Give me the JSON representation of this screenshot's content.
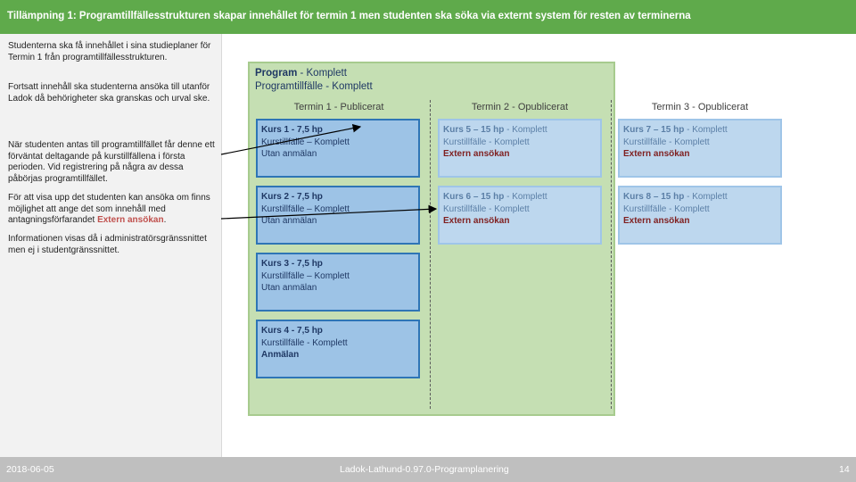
{
  "header": {
    "title": "Tillämpning 1: Programtillfällesstrukturen skapar innehållet för termin 1 men studenten ska söka via externt system för resten av terminerna"
  },
  "sidebar": {
    "p1": "Studenterna ska få innehållet i sina studieplaner för Termin 1 från programtillfällesstrukturen.",
    "p2": "Fortsatt innehåll ska studenterna ansöka till utanför Ladok då behörigheter ska granskas och urval ske.",
    "p3": "När studenten antas till programtillfället får denne ett förväntat deltagande på kurstillfällena i första perioden. Vid registrering på några av dessa påbörjas programtillfället.",
    "p4_a": "För att visa upp det studenten kan ansöka om finns möjlighet att ange det som innehåll med antagningsförfarandet ",
    "p4_ext": "Extern ansökan",
    "p4_b": ".",
    "p5": "Informationen visas då i administratörsgränssnittet men ej i studentgränssnittet."
  },
  "program": {
    "label": "Program",
    "label_rest": " - Komplett",
    "tillfalle": "Programtillfälle - Komplett"
  },
  "terms": [
    {
      "label": "Termin 1 - Publicerat"
    },
    {
      "label": "Termin 2 - Opublicerat"
    },
    {
      "label": "Termin 3 - Opublicerat"
    }
  ],
  "courses": [
    {
      "title": "Kurs 1 - 7,5 hp",
      "title_rest": "",
      "status": "Kurstillfälle – Komplett",
      "mode": "Utan anmälan"
    },
    {
      "title": "Kurs 2 - 7,5 hp",
      "title_rest": "",
      "status": "Kurstillfälle – Komplett",
      "mode": "Utan anmälan"
    },
    {
      "title": "Kurs 3 - 7,5 hp",
      "title_rest": "",
      "status": "Kurstillfälle – Komplett",
      "mode": "Utan anmälan"
    },
    {
      "title": "Kurs 4 - 7,5 hp",
      "title_rest": "",
      "status": "Kurstillfälle - Komplett",
      "mode": "Anmälan"
    },
    {
      "title": "Kurs 5 – 15 hp",
      "title_rest": " - Komplett",
      "status": "Kurstillfälle - Komplett",
      "mode": "Extern ansökan"
    },
    {
      "title": "Kurs 6 – 15 hp",
      "title_rest": " - Komplett",
      "status": "Kurstillfälle - Komplett",
      "mode": "Extern ansökan"
    },
    {
      "title": "Kurs 7 – 15 hp",
      "title_rest": " - Komplett",
      "status": "Kurstillfälle - Komplett",
      "mode": "Extern ansökan"
    },
    {
      "title": "Kurs 8 – 15 hp",
      "title_rest": " - Komplett",
      "status": "Kurstillfälle - Komplett",
      "mode": "Extern ansökan"
    }
  ],
  "footer": {
    "date": "2018-06-05",
    "center": "Ladok-Lathund-0.97.0-Programplanering",
    "page": "14"
  },
  "colors": {
    "header": "#5faa4b",
    "program_bg": "#c5dfb3",
    "published_course": "#9dc3e6",
    "unpublished_course": "#bdd7ee",
    "external_text": "#c0504d"
  }
}
